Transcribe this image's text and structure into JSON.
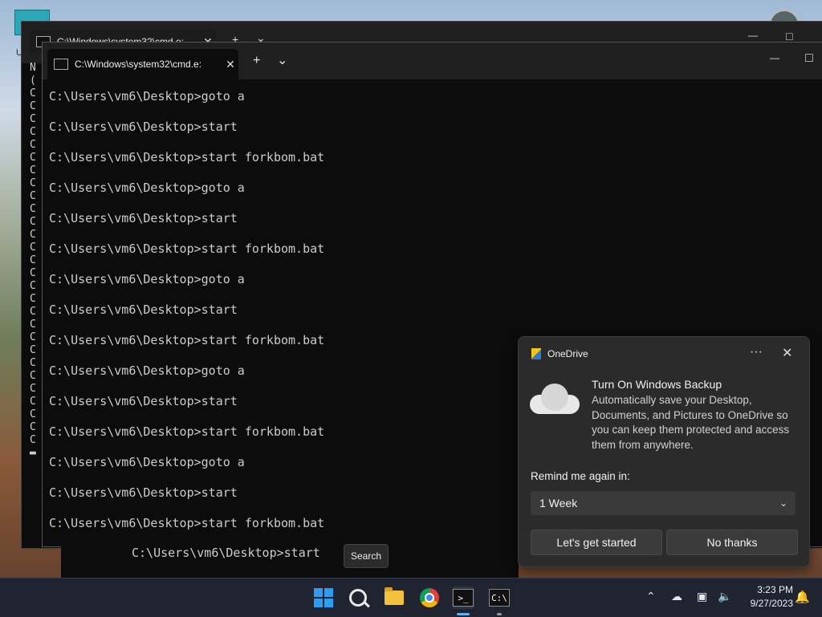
{
  "back_window": {
    "tab_title": "C:\\Windows\\system32\\cmd.e:",
    "new_tab": "+",
    "dropdown": "⌄",
    "minimize": "—",
    "maximize": "□",
    "left_chars": [
      "N",
      "(",
      "C",
      "C",
      "C",
      "C",
      "C",
      "C",
      "C",
      "C",
      "C",
      "C",
      "C",
      "C",
      "C",
      "C",
      "C",
      "C",
      "C",
      "C",
      "C",
      "C",
      "C",
      "C",
      "C",
      "C",
      "C",
      "C",
      "C",
      "C",
      "▬"
    ]
  },
  "front_window": {
    "tab_title": "C:\\Windows\\system32\\cmd.e:",
    "new_tab": "+",
    "dropdown": "⌄",
    "minimize": "—",
    "maximize": "□",
    "lines": [
      "C:\\Users\\vm6\\Desktop>goto a",
      "C:\\Users\\vm6\\Desktop>start",
      "C:\\Users\\vm6\\Desktop>start forkbom.bat",
      "C:\\Users\\vm6\\Desktop>goto a",
      "C:\\Users\\vm6\\Desktop>start",
      "C:\\Users\\vm6\\Desktop>start forkbom.bat",
      "C:\\Users\\vm6\\Desktop>goto a",
      "C:\\Users\\vm6\\Desktop>start",
      "C:\\Users\\vm6\\Desktop>start forkbom.bat",
      "C:\\Users\\vm6\\Desktop>goto a",
      "C:\\Users\\vm6\\Desktop>start",
      "C:\\Users\\vm6\\Desktop>start forkbom.bat",
      "C:\\Users\\vm6\\Desktop>goto a",
      "C:\\Users\\vm6\\Desktop>start",
      "C:\\Users\\vm6\\Desktop>start forkbom.bat"
    ]
  },
  "behind_line": "C:\\Users\\vm6\\Desktop>start",
  "tooltip": "Search",
  "toast": {
    "app_name": "OneDrive",
    "more": "···",
    "close": "✕",
    "title": "Turn On Windows Backup",
    "body": "Automatically save your Desktop, Documents, and Pictures to OneDrive so you can keep them protected and access them from anywhere.",
    "remind_label": "Remind me again in:",
    "remind_value": "1 Week",
    "chevron": "⌄",
    "primary_button": "Let's get started",
    "secondary_button": "No thanks"
  },
  "taskbar": {
    "terminal_glyph": ">_",
    "cmd_glyph": "C:\\",
    "tray_chevron": "⌃",
    "tray_cloud": "☁",
    "tray_network": "▣",
    "tray_volume": "🔈",
    "time": "3:23 PM",
    "date": "9/27/2023",
    "bell": "🔔"
  },
  "desktop_label": "U"
}
